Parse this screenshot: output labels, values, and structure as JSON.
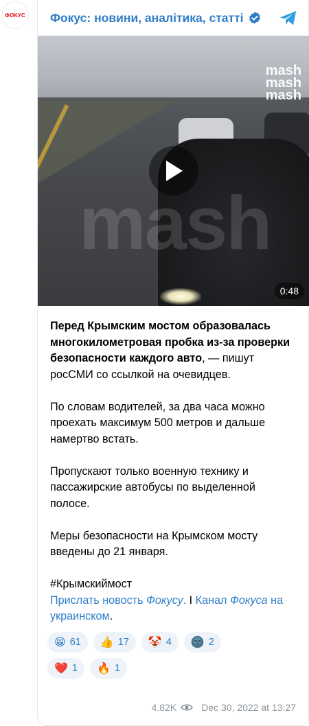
{
  "avatar": {
    "label": "ФОКУС"
  },
  "header": {
    "channel_name": "Фокус: новини, аналітика, статті"
  },
  "media": {
    "watermark_lines": [
      "mash",
      "mash",
      "mash"
    ],
    "big_watermark": "mash",
    "duration": "0:48"
  },
  "post": {
    "p1_bold": "Перед Крымским мостом образовалась многокилометровая пробка из-за проверки безопасности каждого авто",
    "p1_rest": ", — пишут росСМИ со ссылкой на очевидцев.",
    "p2": "По словам водителей, за два часа можно проехать максимум 500 метров и дальше намертво встать.",
    "p3": "Пропускают только военную технику и пассажирские автобусы по выделенной полосе.",
    "p4": "Меры безопасности на Крымском мосту введены до 21 января.",
    "hashtag": "#Крымскиймост",
    "link1_a": "Прислать новость ",
    "link1_b": "Фокусу",
    "link1_c": ".",
    "separator": " I ",
    "link2_a": "Канал ",
    "link2_b": "Фокуса",
    "link2_c": " на украинском",
    "end": "."
  },
  "reactions": [
    {
      "emoji": "😁",
      "count": "61"
    },
    {
      "emoji": "👍",
      "count": "17"
    },
    {
      "emoji": "🤡",
      "count": "4"
    },
    {
      "emoji": "🌚",
      "count": "2"
    },
    {
      "emoji": "❤️",
      "count": "1"
    },
    {
      "emoji": "🔥",
      "count": "1"
    }
  ],
  "footer": {
    "views": "4.82K",
    "date": "Dec 30, 2022 at 13:27"
  },
  "colors": {
    "link": "#2f7dc7",
    "reaction_bg": "#eef3f9",
    "meta": "#8b9399",
    "brand_red": "#e30613"
  }
}
